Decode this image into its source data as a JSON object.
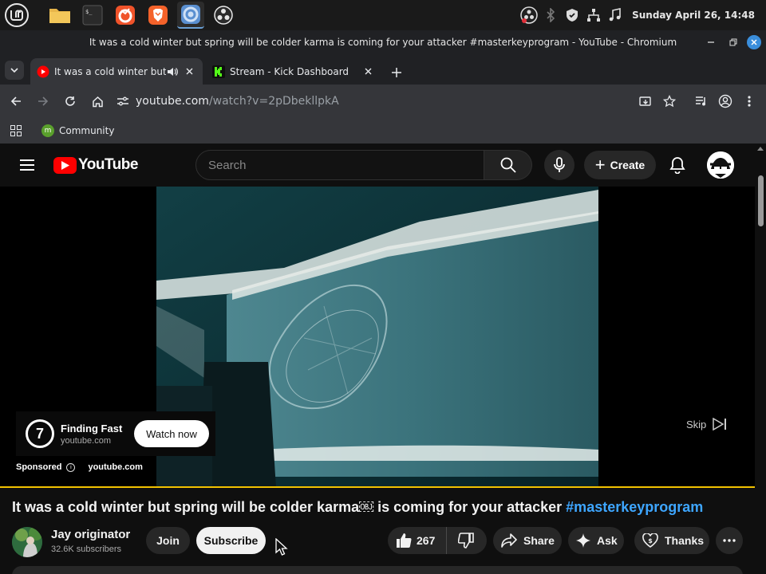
{
  "os_panel": {
    "clock": "Sunday April 26, 14:48",
    "apps": [
      "mint-menu",
      "files",
      "terminal",
      "firefox",
      "brave",
      "chromium",
      "obs"
    ]
  },
  "window": {
    "title": "It was a cold winter but spring will be colder karma￼ is coming for your attacker #masterkeyprogram - YouTube - Chromium"
  },
  "tabs": [
    {
      "label": "It was a cold winter but spring will be colder karma",
      "favicon": "youtube-icon",
      "active": true,
      "audio": true
    },
    {
      "label": "Stream - Kick Dashboard",
      "favicon": "kick-icon",
      "active": false,
      "audio": false
    }
  ],
  "toolbar": {
    "url_host": "youtube.com",
    "url_path": "/watch?v=2pDbekllpkA"
  },
  "bookmarks": [
    {
      "label": "Community"
    }
  ],
  "youtube": {
    "logo_text": "YouTube",
    "search_placeholder": "Search",
    "create_label": "Create",
    "ad": {
      "advertiser": "Finding Fast",
      "domain": "youtube.com",
      "cta": "Watch now",
      "sponsored_label": "Sponsored",
      "sponsored_domain": "youtube.com",
      "skip_label": "Skip",
      "progress": 1.0
    },
    "video": {
      "title_main": "It was a cold winter but spring will be colder karma￼ is coming for your attacker ",
      "title_hashtag": "#masterkeyprogram",
      "channel_name": "Jay originator",
      "subscribers": "32.6K subscribers",
      "join_label": "Join",
      "subscribe_label": "Subscribe",
      "likes": "267",
      "share_label": "Share",
      "ask_label": "Ask",
      "thanks_label": "Thanks"
    }
  },
  "colors": {
    "yt_red": "#ff0000",
    "progress_yellow": "#f2c200",
    "hashtag_blue": "#3ea6ff",
    "chrome_dark": "#35363a"
  }
}
